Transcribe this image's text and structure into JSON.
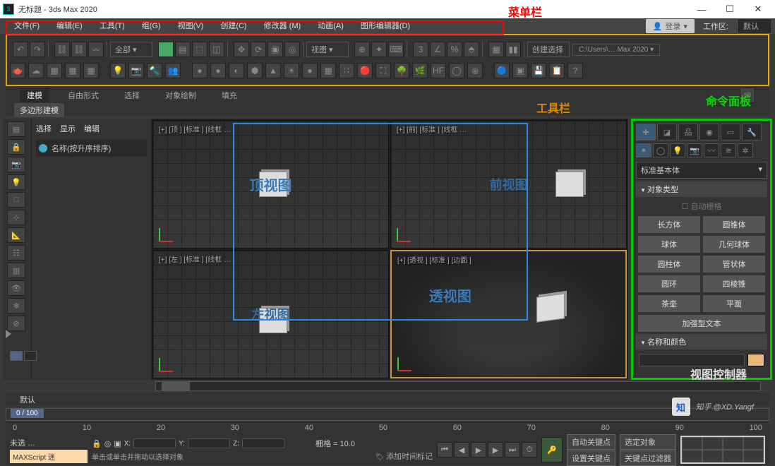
{
  "window": {
    "title": "无标题 - 3ds Max 2020",
    "appicon": "3"
  },
  "winbtns": {
    "min": "—",
    "max": "☐",
    "close": "✕"
  },
  "menu": {
    "file": "文件(F)",
    "edit": "编辑(E)",
    "tools": "工具(T)",
    "group": "组(G)",
    "views": "视图(V)",
    "create": "创建(C)",
    "modifiers": "修改器 (M)",
    "anim": "动画(A)",
    "graph": "图形编辑器(D)"
  },
  "login": "登录",
  "workspace_label": "工作区:",
  "workspace_value": "默认",
  "toolbar": {
    "all": "全部",
    "view": "视图",
    "create_sel": "创建选择",
    "path": "C:\\Users\\… Max 2020 ▾"
  },
  "ribbon": {
    "model": "建模",
    "freeform": "自由形式",
    "select": "选择",
    "objpaint": "对象绘制",
    "fill": "填充"
  },
  "subribbon": "多边形建模",
  "scene": {
    "tab_sel": "选择",
    "tab_disp": "显示",
    "tab_edit": "编辑",
    "name_label": "名称(按升序排序)"
  },
  "viewports": {
    "top": {
      "label": "[+] [顶 ] [标准 ] [线框 …",
      "overlay": "顶视图"
    },
    "front": {
      "label": "[+] [前] [标准 ] [线框 …",
      "overlay": "前视图"
    },
    "left": {
      "label": "[+] [左 ] [标准 ] [线框 …",
      "overlay": "左视图"
    },
    "persp": {
      "label": "[+] [透视 ] [标准 ] [边面 ]",
      "overlay": "透视图"
    }
  },
  "cmd": {
    "dropdown": "标准基本体",
    "rollout_objtype": "对象类型",
    "auto_grid": "自动栅格",
    "objects": [
      "长方体",
      "圆锥体",
      "球体",
      "几何球体",
      "圆柱体",
      "管状体",
      "圆环",
      "四棱锥",
      "茶壶",
      "平面",
      "加强型文本"
    ],
    "rollout_name": "名称和颜色"
  },
  "timeline": {
    "indicator": "0 / 100",
    "ticks": [
      "0",
      "10",
      "20",
      "30",
      "40",
      "50",
      "60",
      "70",
      "80",
      "90",
      "100"
    ]
  },
  "status": {
    "nosel": "未选 …",
    "mxs": "MAXScript 迷",
    "hint1": "单击或单击并拖动以选择对象",
    "grid": "栅格 = 10.0",
    "addtime": "添加时间标记",
    "autokey": "自动关键点",
    "setkey": "设置关键点",
    "keyfilter": "关键点过滤器",
    "selected": "选定对象"
  },
  "layer_default": "默认",
  "annotations": {
    "menubar": "菜单栏",
    "toolbar": "工具栏",
    "cmdpanel": "命令面板",
    "viewctrl": "视图控制器"
  },
  "watermark": {
    "icon": "知",
    "text": "知乎 @XD.Yangf"
  }
}
